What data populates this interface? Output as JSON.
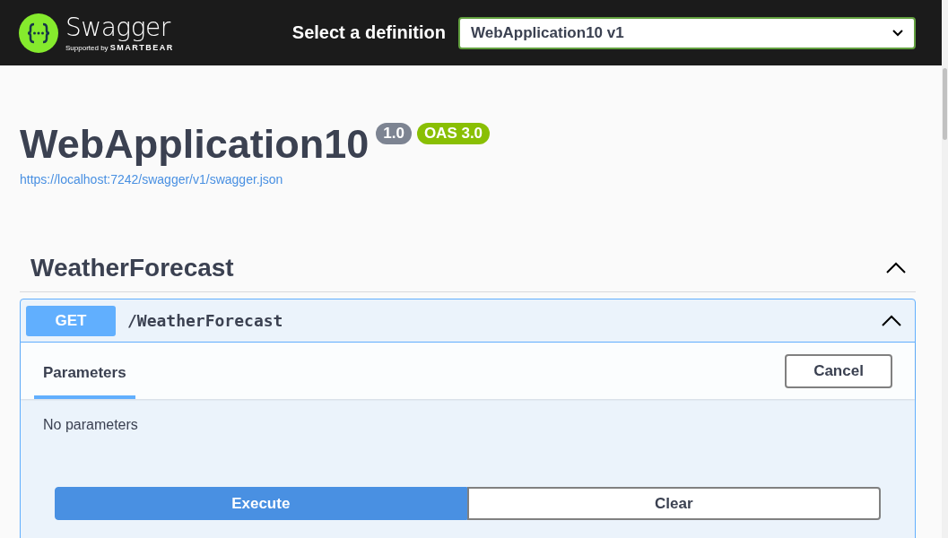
{
  "topbar": {
    "logo": {
      "name": "Swagger",
      "tagline_prefix": "Supported by",
      "tagline_brand": "SMARTBEAR"
    },
    "definition_label": "Select a definition",
    "definition_value": "WebApplication10 v1"
  },
  "info": {
    "title": "WebApplication10",
    "version": "1.0",
    "oas": "OAS 3.0",
    "url": "https://localhost:7242/swagger/v1/swagger.json"
  },
  "tag": {
    "name": "WeatherForecast",
    "expanded": true,
    "operations": [
      {
        "method": "GET",
        "path": "/WeatherForecast",
        "expanded": true,
        "tabs": [
          {
            "label": "Parameters",
            "selected": true
          }
        ],
        "cancel_button": "Cancel",
        "params_text": "No parameters",
        "execute_button": "Execute",
        "clear_button": "Clear"
      }
    ]
  }
}
